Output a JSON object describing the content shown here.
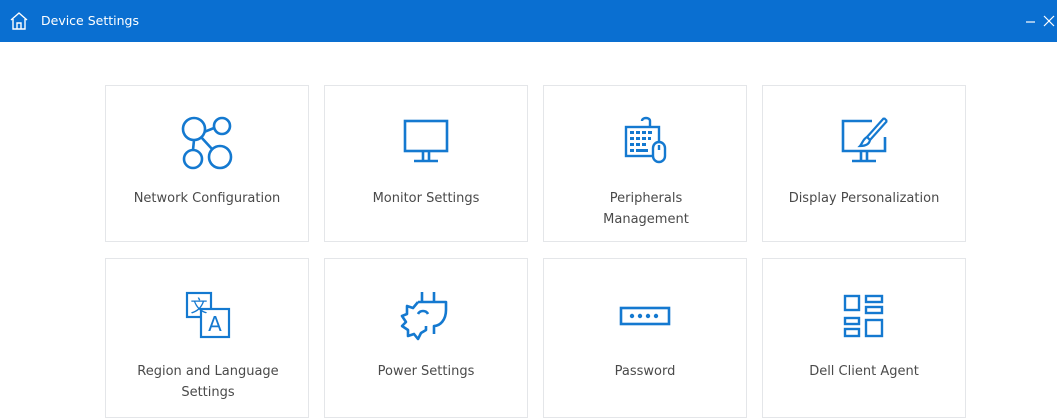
{
  "window": {
    "title": "Device Settings",
    "minimize_glyph": "–",
    "close_glyph": "×"
  },
  "accent_color": "#0a6fd1",
  "tiles": [
    {
      "label": "Network Configuration",
      "icon": "network-icon"
    },
    {
      "label": "Monitor Settings",
      "icon": "monitor-icon"
    },
    {
      "label": "Peripherals Management",
      "icon": "peripherals-icon"
    },
    {
      "label": "Display Personalization",
      "icon": "display-personalization-icon"
    },
    {
      "label": "Region and Language Settings",
      "icon": "region-language-icon"
    },
    {
      "label": "Power Settings",
      "icon": "power-plug-icon"
    },
    {
      "label": "Password",
      "icon": "password-icon"
    },
    {
      "label": "Dell Client Agent",
      "icon": "dell-client-agent-icon"
    }
  ]
}
